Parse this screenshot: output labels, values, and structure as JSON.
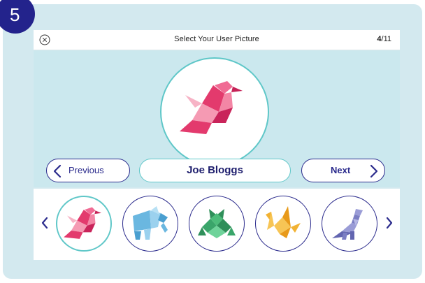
{
  "step_badge": "5",
  "header": {
    "close_icon": "close-circle-icon",
    "title": "Select Your User Picture",
    "counter_current": "4",
    "counter_total": "/11"
  },
  "stage": {
    "selected_avatar": "origami-bird-icon",
    "name": "Joe Bloggs"
  },
  "buttons": {
    "previous": "Previous",
    "next": "Next"
  },
  "carousel": {
    "items": [
      {
        "icon": "origami-bird-icon",
        "selected": true
      },
      {
        "icon": "origami-elephant-icon",
        "selected": false
      },
      {
        "icon": "origami-frog-icon",
        "selected": false
      },
      {
        "icon": "origami-crane-icon",
        "selected": false
      },
      {
        "icon": "origami-dinosaur-icon",
        "selected": false
      }
    ]
  },
  "colors": {
    "accent_navy": "#23238c",
    "accent_teal": "#5fc7c8",
    "bird": "#e0396a",
    "elephant": "#6ab7e0",
    "frog": "#3aa56a",
    "crane": "#f2b233",
    "dinosaur": "#7b7ec3"
  }
}
